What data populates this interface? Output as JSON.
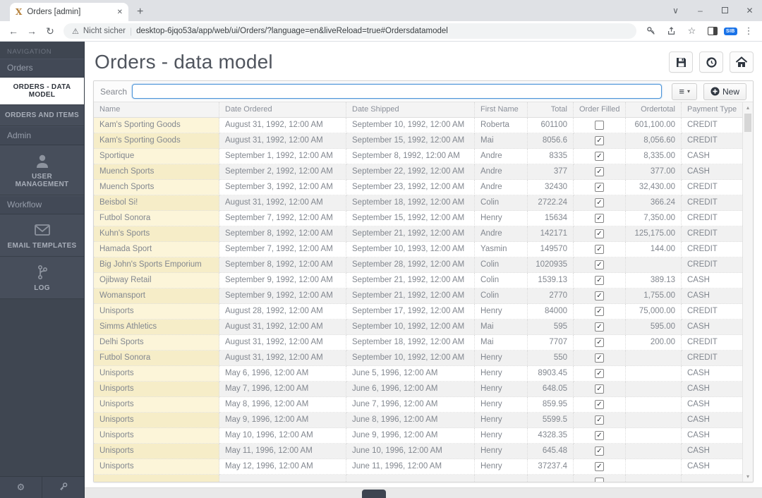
{
  "chrome": {
    "tab": {
      "title": "Orders [admin]",
      "favicon_letter": "X",
      "close": "✕"
    },
    "new_tab": "+",
    "window_controls": {
      "search_tabs": "∨",
      "minimize": "–",
      "close": "✕"
    },
    "icons": {
      "back": "←",
      "forward": "→",
      "reload": "↻",
      "warning": "⚠",
      "star": "☆",
      "menu_dots": "⋮"
    },
    "address_bar": {
      "security_label": "Nicht sicher",
      "separator": "|",
      "url": "desktop-6jqo53a/app/web/ui/Orders/?language=en&liveReload=true#Ordersdatamodel"
    },
    "extension_badge": "SIB"
  },
  "sidebar": {
    "nav_header": "NAVIGATION",
    "groups": [
      {
        "label": "Orders",
        "items": [
          {
            "label": "ORDERS - DATA MODEL",
            "active": true
          },
          {
            "label": "ORDERS AND ITEMS",
            "active": false
          }
        ]
      },
      {
        "label": "Admin",
        "items": [
          {
            "label": "USER MANAGEMENT",
            "icon": "user-icon"
          }
        ]
      },
      {
        "label": "Workflow",
        "items": [
          {
            "label": "EMAIL TEMPLATES",
            "icon": "envelope-icon"
          },
          {
            "label": "LOG",
            "icon": "branch-icon"
          }
        ]
      }
    ],
    "footer": {
      "gear": "⚙"
    }
  },
  "main": {
    "title": "Orders - data model",
    "header_icons": {
      "save": "floppy-disk",
      "history": "clock-arrow",
      "home": "house"
    },
    "search": {
      "label": "Search",
      "value": ""
    },
    "actions": {
      "menu_icon": "≡",
      "menu_chevron": "▾",
      "new_label": "New"
    },
    "table": {
      "columns": [
        {
          "key": "name",
          "label": "Name",
          "align": "left"
        },
        {
          "key": "ordered",
          "label": "Date Ordered",
          "align": "left"
        },
        {
          "key": "shipped",
          "label": "Date Shipped",
          "align": "left"
        },
        {
          "key": "first_name",
          "label": "First Name",
          "align": "left"
        },
        {
          "key": "total",
          "label": "Total",
          "align": "right"
        },
        {
          "key": "filled",
          "label": "Order Filled",
          "align": "center",
          "type": "checkbox"
        },
        {
          "key": "ordertotal",
          "label": "Ordertotal",
          "align": "right"
        },
        {
          "key": "payment",
          "label": "Payment Type",
          "align": "left"
        }
      ],
      "rows": [
        {
          "name": "Kam's Sporting Goods",
          "ordered": "August 31, 1992, 12:00 AM",
          "shipped": "September 10, 1992, 12:00 AM",
          "first_name": "Roberta",
          "total": "601100",
          "filled": false,
          "ordertotal": "601,100.00",
          "payment": "CREDIT"
        },
        {
          "name": "Kam's Sporting Goods",
          "ordered": "August 31, 1992, 12:00 AM",
          "shipped": "September 15, 1992, 12:00 AM",
          "first_name": "Mai",
          "total": "8056.6",
          "filled": true,
          "ordertotal": "8,056.60",
          "payment": "CREDIT"
        },
        {
          "name": "Sportique",
          "ordered": "September 1, 1992, 12:00 AM",
          "shipped": "September 8, 1992, 12:00 AM",
          "first_name": "Andre",
          "total": "8335",
          "filled": true,
          "ordertotal": "8,335.00",
          "payment": "CASH"
        },
        {
          "name": "Muench Sports",
          "ordered": "September 2, 1992, 12:00 AM",
          "shipped": "September 22, 1992, 12:00 AM",
          "first_name": "Andre",
          "total": "377",
          "filled": true,
          "ordertotal": "377.00",
          "payment": "CASH"
        },
        {
          "name": "Muench Sports",
          "ordered": "September 3, 1992, 12:00 AM",
          "shipped": "September 23, 1992, 12:00 AM",
          "first_name": "Andre",
          "total": "32430",
          "filled": true,
          "ordertotal": "32,430.00",
          "payment": "CREDIT"
        },
        {
          "name": "Beisbol Si!",
          "ordered": "August 31, 1992, 12:00 AM",
          "shipped": "September 18, 1992, 12:00 AM",
          "first_name": "Colin",
          "total": "2722.24",
          "filled": true,
          "ordertotal": "366.24",
          "payment": "CREDIT"
        },
        {
          "name": "Futbol Sonora",
          "ordered": "September 7, 1992, 12:00 AM",
          "shipped": "September 15, 1992, 12:00 AM",
          "first_name": "Henry",
          "total": "15634",
          "filled": true,
          "ordertotal": "7,350.00",
          "payment": "CREDIT"
        },
        {
          "name": "Kuhn's Sports",
          "ordered": "September 8, 1992, 12:00 AM",
          "shipped": "September 21, 1992, 12:00 AM",
          "first_name": "Andre",
          "total": "142171",
          "filled": true,
          "ordertotal": "125,175.00",
          "payment": "CREDIT"
        },
        {
          "name": "Hamada Sport",
          "ordered": "September 7, 1992, 12:00 AM",
          "shipped": "September 10, 1993, 12:00 AM",
          "first_name": "Yasmin",
          "total": "149570",
          "filled": true,
          "ordertotal": "144.00",
          "payment": "CREDIT"
        },
        {
          "name": "Big John's Sports Emporium",
          "ordered": "September 8, 1992, 12:00 AM",
          "shipped": "September 28, 1992, 12:00 AM",
          "first_name": "Colin",
          "total": "1020935",
          "filled": true,
          "ordertotal": "",
          "payment": "CREDIT"
        },
        {
          "name": "Ojibway Retail",
          "ordered": "September 9, 1992, 12:00 AM",
          "shipped": "September 21, 1992, 12:00 AM",
          "first_name": "Colin",
          "total": "1539.13",
          "filled": true,
          "ordertotal": "389.13",
          "payment": "CASH"
        },
        {
          "name": "Womansport",
          "ordered": "September 9, 1992, 12:00 AM",
          "shipped": "September 21, 1992, 12:00 AM",
          "first_name": "Colin",
          "total": "2770",
          "filled": true,
          "ordertotal": "1,755.00",
          "payment": "CASH"
        },
        {
          "name": "Unisports",
          "ordered": "August 28, 1992, 12:00 AM",
          "shipped": "September 17, 1992, 12:00 AM",
          "first_name": "Henry",
          "total": "84000",
          "filled": true,
          "ordertotal": "75,000.00",
          "payment": "CREDIT"
        },
        {
          "name": "Simms Athletics",
          "ordered": "August 31, 1992, 12:00 AM",
          "shipped": "September 10, 1992, 12:00 AM",
          "first_name": "Mai",
          "total": "595",
          "filled": true,
          "ordertotal": "595.00",
          "payment": "CASH"
        },
        {
          "name": "Delhi Sports",
          "ordered": "August 31, 1992, 12:00 AM",
          "shipped": "September 18, 1992, 12:00 AM",
          "first_name": "Mai",
          "total": "7707",
          "filled": true,
          "ordertotal": "200.00",
          "payment": "CREDIT"
        },
        {
          "name": "Futbol Sonora",
          "ordered": "August 31, 1992, 12:00 AM",
          "shipped": "September 10, 1992, 12:00 AM",
          "first_name": "Henry",
          "total": "550",
          "filled": true,
          "ordertotal": "",
          "payment": "CREDIT"
        },
        {
          "name": "Unisports",
          "ordered": "May 6, 1996, 12:00 AM",
          "shipped": "June 5, 1996, 12:00 AM",
          "first_name": "Henry",
          "total": "8903.45",
          "filled": true,
          "ordertotal": "",
          "payment": "CASH"
        },
        {
          "name": "Unisports",
          "ordered": "May 7, 1996, 12:00 AM",
          "shipped": "June 6, 1996, 12:00 AM",
          "first_name": "Henry",
          "total": "648.05",
          "filled": true,
          "ordertotal": "",
          "payment": "CASH"
        },
        {
          "name": "Unisports",
          "ordered": "May 8, 1996, 12:00 AM",
          "shipped": "June 7, 1996, 12:00 AM",
          "first_name": "Henry",
          "total": "859.95",
          "filled": true,
          "ordertotal": "",
          "payment": "CASH"
        },
        {
          "name": "Unisports",
          "ordered": "May 9, 1996, 12:00 AM",
          "shipped": "June 8, 1996, 12:00 AM",
          "first_name": "Henry",
          "total": "5599.5",
          "filled": true,
          "ordertotal": "",
          "payment": "CASH"
        },
        {
          "name": "Unisports",
          "ordered": "May 10, 1996, 12:00 AM",
          "shipped": "June 9, 1996, 12:00 AM",
          "first_name": "Henry",
          "total": "4328.35",
          "filled": true,
          "ordertotal": "",
          "payment": "CASH"
        },
        {
          "name": "Unisports",
          "ordered": "May 11, 1996, 12:00 AM",
          "shipped": "June 10, 1996, 12:00 AM",
          "first_name": "Henry",
          "total": "645.48",
          "filled": true,
          "ordertotal": "",
          "payment": "CASH"
        },
        {
          "name": "Unisports",
          "ordered": "May 12, 1996, 12:00 AM",
          "shipped": "June 11, 1996, 12:00 AM",
          "first_name": "Henry",
          "total": "37237.4",
          "filled": true,
          "ordertotal": "",
          "payment": "CASH"
        }
      ]
    },
    "scrollbar": {
      "up": "▴",
      "down": "▾"
    }
  }
}
